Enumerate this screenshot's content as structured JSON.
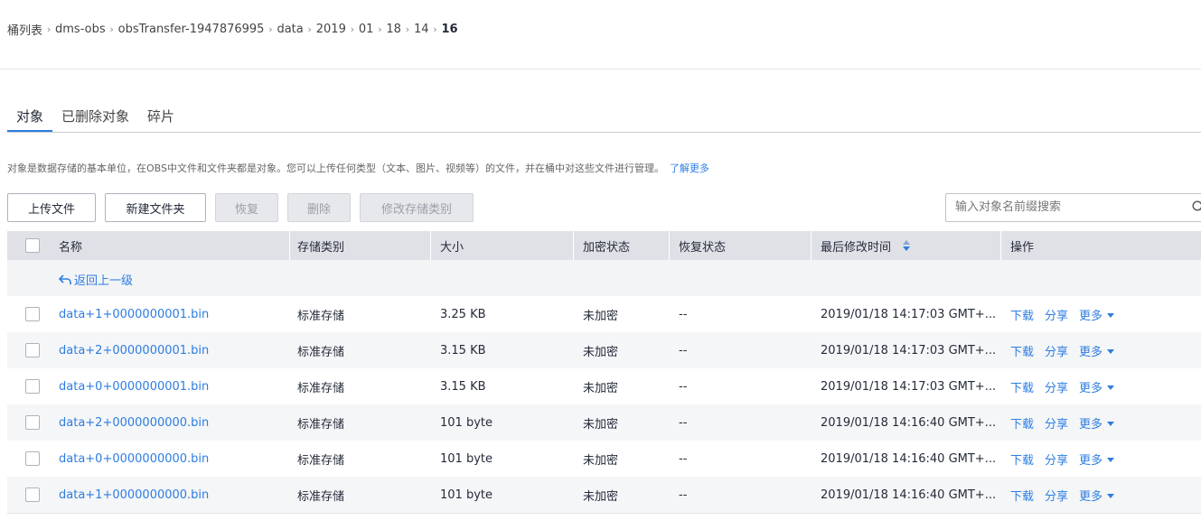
{
  "breadcrumb": {
    "items": [
      "桶列表",
      "dms-obs",
      "obsTransfer-1947876995",
      "data",
      "2019",
      "01",
      "18",
      "14"
    ],
    "current": "16",
    "separator": "›"
  },
  "tabs": [
    {
      "label": "对象",
      "active": true
    },
    {
      "label": "已删除对象",
      "active": false
    },
    {
      "label": "碎片",
      "active": false
    }
  ],
  "description": {
    "text": "对象是数据存储的基本单位，在OBS中文件和文件夹都是对象。您可以上传任何类型（文本、图片、视频等）的文件，并在桶中对这些文件进行管理。",
    "link": "了解更多"
  },
  "toolbar": {
    "upload": "上传文件",
    "new_folder": "新建文件夹",
    "restore": "恢复",
    "delete": "删除",
    "change_storage": "修改存储类别"
  },
  "search": {
    "placeholder": "输入对象名前缀搜索",
    "value": ""
  },
  "table": {
    "headers": {
      "name": "名称",
      "storage": "存储类别",
      "size": "大小",
      "encryption": "加密状态",
      "restore": "恢复状态",
      "modified": "最后修改时间",
      "actions": "操作"
    },
    "back_link": "返回上一级",
    "action_labels": {
      "download": "下载",
      "share": "分享",
      "more": "更多"
    },
    "rows": [
      {
        "name": "data+1+0000000001.bin",
        "storage": "标准存储",
        "size": "3.25 KB",
        "encryption": "未加密",
        "restore": "--",
        "modified": "2019/01/18 14:17:03 GMT+..."
      },
      {
        "name": "data+2+0000000001.bin",
        "storage": "标准存储",
        "size": "3.15 KB",
        "encryption": "未加密",
        "restore": "--",
        "modified": "2019/01/18 14:17:03 GMT+..."
      },
      {
        "name": "data+0+0000000001.bin",
        "storage": "标准存储",
        "size": "3.15 KB",
        "encryption": "未加密",
        "restore": "--",
        "modified": "2019/01/18 14:17:03 GMT+..."
      },
      {
        "name": "data+2+0000000000.bin",
        "storage": "标准存储",
        "size": "101 byte",
        "encryption": "未加密",
        "restore": "--",
        "modified": "2019/01/18 14:16:40 GMT+..."
      },
      {
        "name": "data+0+0000000000.bin",
        "storage": "标准存储",
        "size": "101 byte",
        "encryption": "未加密",
        "restore": "--",
        "modified": "2019/01/18 14:16:40 GMT+..."
      },
      {
        "name": "data+1+0000000000.bin",
        "storage": "标准存储",
        "size": "101 byte",
        "encryption": "未加密",
        "restore": "--",
        "modified": "2019/01/18 14:16:40 GMT+..."
      }
    ]
  },
  "colors": {
    "accent": "#2e7de1",
    "header_bg": "#dfe1e6",
    "alt_row_bg": "#f5f6f7"
  }
}
